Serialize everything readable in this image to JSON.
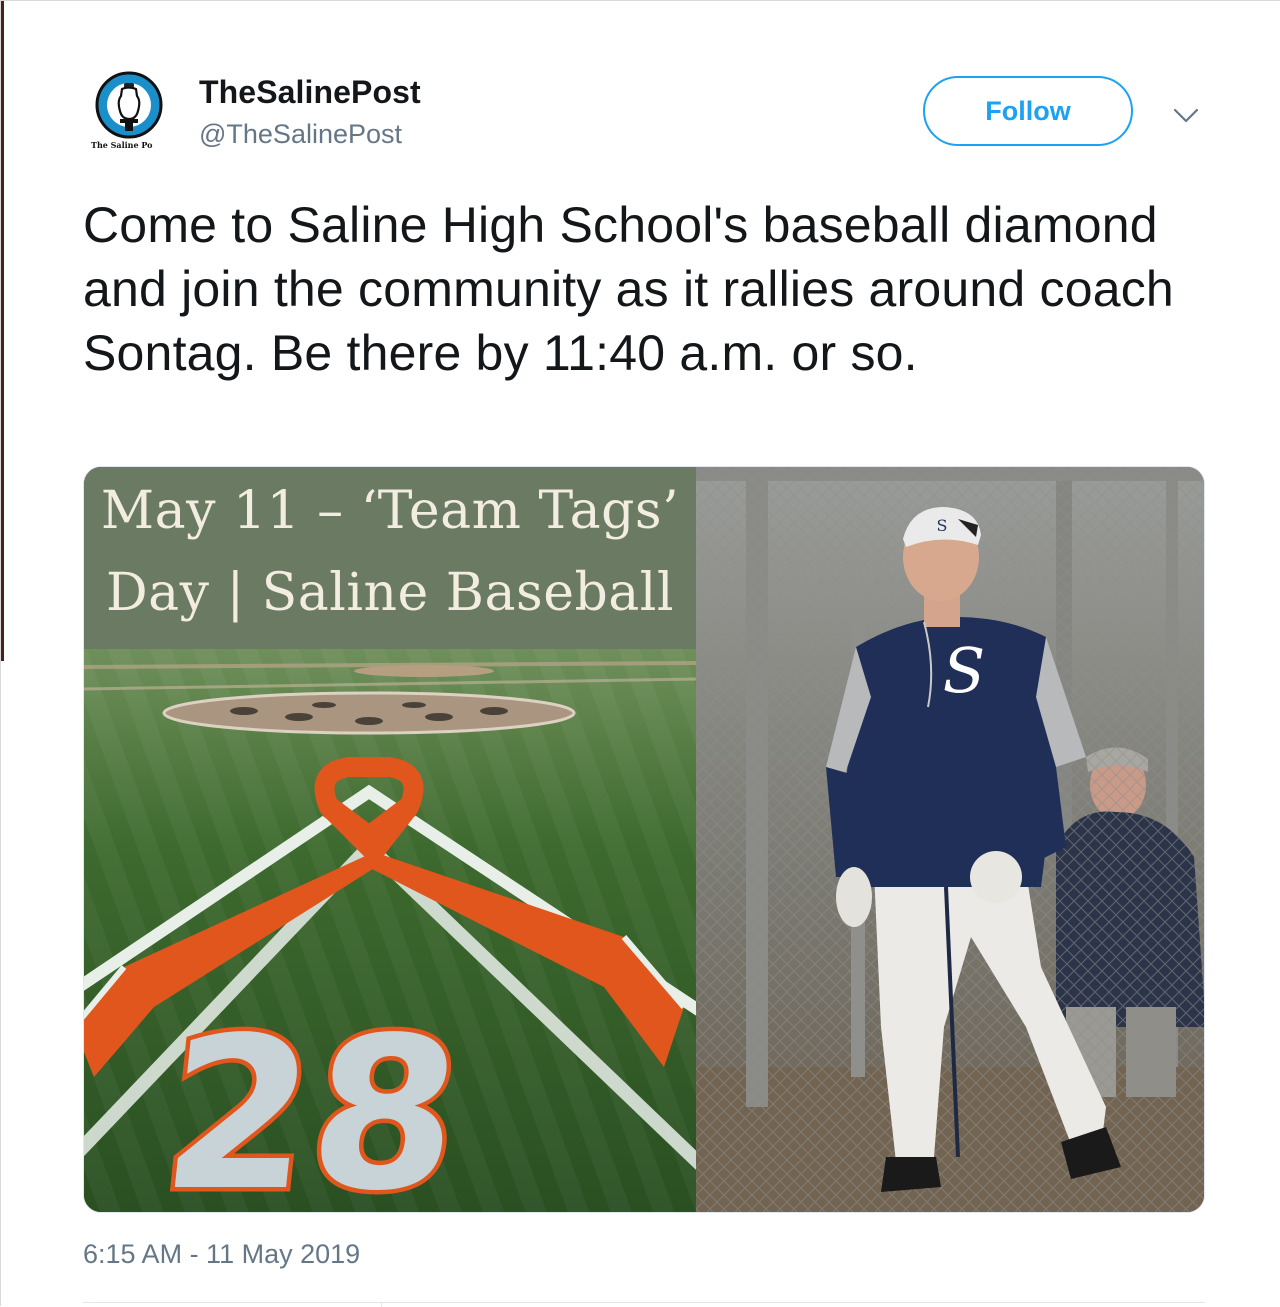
{
  "user": {
    "display_name": "TheSalinePost",
    "handle": "@TheSalinePost",
    "avatar_caption": "The Saline Po"
  },
  "actions": {
    "follow_label": "Follow",
    "menu_icon": "chevron-down-icon"
  },
  "tweet": {
    "text": "Come to Saline High School's baseball diamond and join the community as it rallies around coach Sontag. Be there by 11:40 a.m. or so.",
    "timestamp": "6:15 AM - 11 May 2019"
  },
  "media": {
    "left_banner_line1": "May 11 – ‘Team Tags’",
    "left_banner_line2": "Day | Saline Baseball",
    "field_number": "28",
    "jersey_letter": "S"
  },
  "colors": {
    "accent": "#1da1f2",
    "text": "#14171a",
    "secondary_text": "#657786",
    "banner_bg": "#6a7a63",
    "ribbon": "#e0561c"
  }
}
